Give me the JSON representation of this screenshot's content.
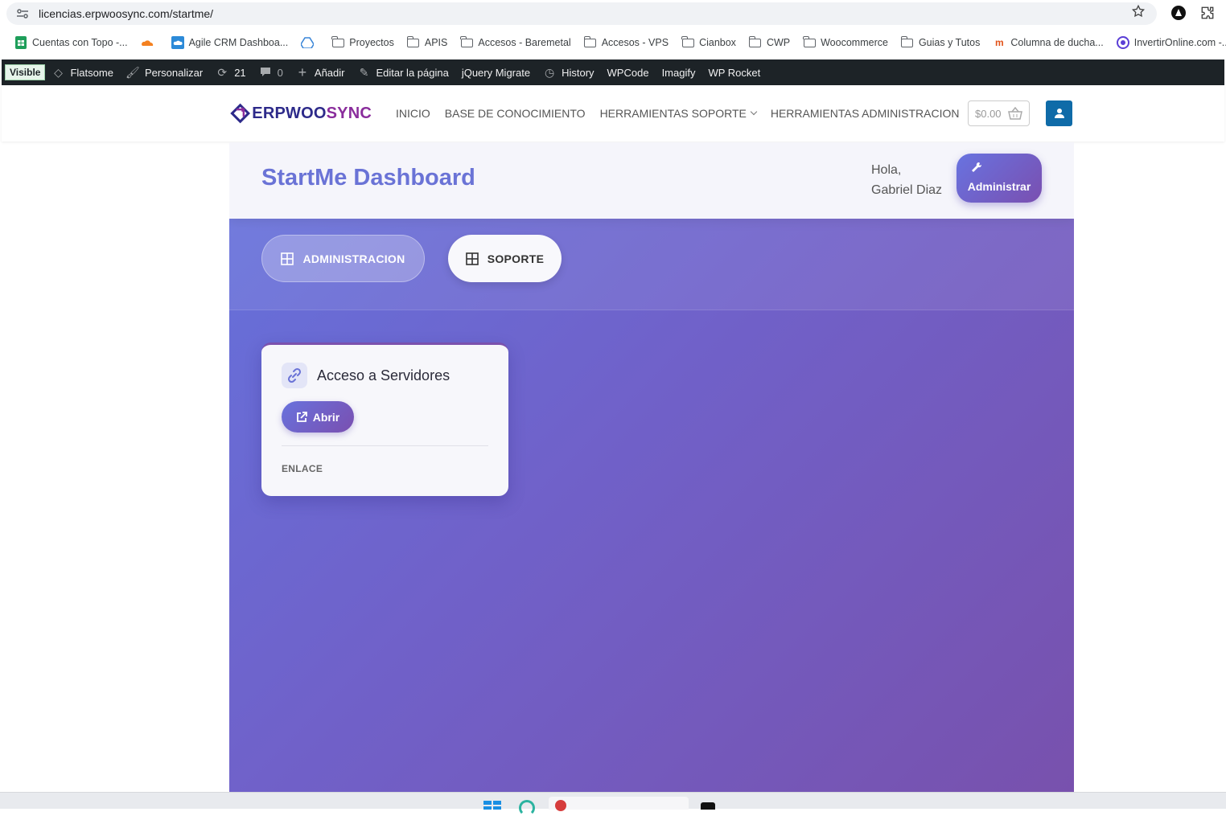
{
  "browser": {
    "url": "licencias.erpwoosync.com/startme/",
    "bookmarks": [
      {
        "label": "Cuentas con Topo -...",
        "icon": "sheets-icon"
      },
      {
        "label": "",
        "icon": "cloudflare-icon"
      },
      {
        "label": "Agile CRM Dashboa...",
        "icon": "cloud-icon"
      },
      {
        "label": "",
        "icon": "google-drive-icon"
      },
      {
        "label": "Proyectos",
        "icon": "folder-icon"
      },
      {
        "label": "APIS",
        "icon": "folder-icon"
      },
      {
        "label": "Accesos - Baremetal",
        "icon": "folder-icon"
      },
      {
        "label": "Accesos - VPS",
        "icon": "folder-icon"
      },
      {
        "label": "Cianbox",
        "icon": "folder-icon"
      },
      {
        "label": "CWP",
        "icon": "folder-icon"
      },
      {
        "label": "Woocommerce",
        "icon": "folder-icon"
      },
      {
        "label": "Guias y Tutos",
        "icon": "folder-icon"
      },
      {
        "label": "Columna de ducha...",
        "icon": "mercadolibre-icon"
      },
      {
        "label": "InvertirOnline.com -...",
        "icon": "invertironline-icon"
      }
    ]
  },
  "wpbar": {
    "visible": "Visible",
    "flatsome": "Flatsome",
    "personalizar": "Personalizar",
    "updates": "21",
    "comments": "0",
    "anadir": "Añadir",
    "editar": "Editar la página",
    "jquery": "jQuery Migrate",
    "history": "History",
    "wpcode": "WPCode",
    "imagify": "Imagify",
    "wprocket": "WP Rocket"
  },
  "site": {
    "logo_a": "ERPWOO",
    "logo_b": "SYNC",
    "nav": {
      "inicio": "INICIO",
      "base": "BASE DE CONOCIMIENTO",
      "soporte": "HERRAMIENTAS SOPORTE",
      "admin": "HERRAMIENTAS ADMINISTRACION"
    },
    "cart_total": "$0.00"
  },
  "dashboard": {
    "title": "StartMe Dashboard",
    "greeting_line1": "Hola,",
    "greeting_line2": "Gabriel Diaz",
    "admin_button": "Administrar",
    "tabs": [
      {
        "label": "ADMINISTRACION",
        "active": true
      },
      {
        "label": "SOPORTE",
        "active": false
      }
    ],
    "card": {
      "title": "Acceso a Servidores",
      "open_label": "Abrir",
      "type": "ENLACE"
    }
  },
  "colors": {
    "accent": "#6a73d6",
    "gradient_start": "#6572dc",
    "gradient_end": "#7851ad",
    "wpbar": "#1d2327",
    "user_button": "#0f6ba8"
  }
}
